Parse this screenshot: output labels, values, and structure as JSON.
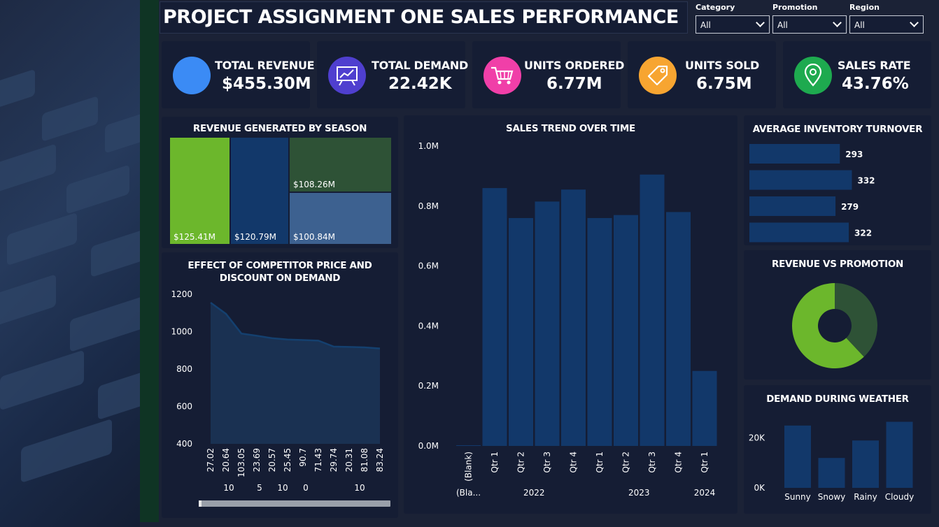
{
  "title": "PROJECT ASSIGNMENT ONE SALES PERFORMANCE",
  "slicers": [
    {
      "label": "Category",
      "value": "All"
    },
    {
      "label": "Promotion",
      "value": "All"
    },
    {
      "label": "Region",
      "value": "All"
    }
  ],
  "kpis": [
    {
      "label": "TOTAL REVENUE",
      "value": "$455.30M",
      "color": "#3b8bf5",
      "icon": "circle-icon"
    },
    {
      "label": "TOTAL DEMAND",
      "value": "22.42K",
      "color": "#4f3fcf",
      "icon": "chart-board-icon"
    },
    {
      "label": "UNITS ORDERED",
      "value": "6.77M",
      "color": "#f03fa8",
      "icon": "cart-icon"
    },
    {
      "label": "UNITS SOLD",
      "value": "6.75M",
      "color": "#f7a531",
      "icon": "tag-icon"
    },
    {
      "label": "SALES RATE",
      "value": "43.76%",
      "color": "#1eaa4f",
      "icon": "location-pin-icon"
    }
  ],
  "season": {
    "title": "REVENUE GENERATED BY SEASON",
    "tiles": [
      {
        "label": "$125.41M",
        "value": 125.41,
        "color": "#6cb72c"
      },
      {
        "label": "$120.79M",
        "value": 120.79,
        "color": "#12386a"
      },
      {
        "label": "$108.26M",
        "value": 108.26,
        "color": "#2e5236"
      },
      {
        "label": "$100.84M",
        "value": 100.84,
        "color": "#3d6190"
      }
    ]
  },
  "competitor": {
    "title_line1": "EFFECT OF COMPETITOR PRICE AND",
    "title_line2": "DISCOUNT ON DEMAND",
    "yticks": [
      "1200",
      "1000",
      "800",
      "600",
      "400"
    ],
    "xlabels": [
      "27.02",
      "20.64",
      "103.05",
      "23.69",
      "20.57",
      "25.45",
      "90.7",
      "71.43",
      "29.74",
      "20.31",
      "81.08",
      "83.24"
    ],
    "groups": [
      {
        "label": "10",
        "pos": 1.5
      },
      {
        "label": "5",
        "pos": 3.5
      },
      {
        "label": "10",
        "pos": 5
      },
      {
        "label": "0",
        "pos": 6.5
      },
      {
        "label": "10",
        "pos": 10
      }
    ]
  },
  "trend": {
    "title": "SALES TREND OVER TIME",
    "yticks": [
      "1.0M",
      "0.8M",
      "0.6M",
      "0.4M",
      "0.2M",
      "0.0M"
    ],
    "years": [
      {
        "label": "(Bla...",
        "from": 0,
        "to": 0
      },
      {
        "label": "2022",
        "from": 1,
        "to": 4
      },
      {
        "label": "2023",
        "from": 5,
        "to": 8
      },
      {
        "label": "2024",
        "from": 9,
        "to": 9
      }
    ]
  },
  "inventory": {
    "title": "AVERAGE INVENTORY TURNOVER",
    "labels": [
      "293",
      "332",
      "279",
      "322"
    ],
    "values": [
      293,
      332,
      279,
      322
    ]
  },
  "promotion": {
    "title": "REVENUE VS PROMOTION",
    "values": [
      62,
      38
    ],
    "colors": [
      "#6cb72c",
      "#2e5236"
    ]
  },
  "weather": {
    "title": "DEMAND DURING WEATHER",
    "yticks": [
      "20K",
      "0K"
    ]
  },
  "chart_data": [
    {
      "type": "bar",
      "title": "SALES TREND OVER TIME",
      "categories": [
        "(Blank)",
        "Qtr 1",
        "Qtr 2",
        "Qtr 3",
        "Qtr 4",
        "Qtr 1",
        "Qtr 2",
        "Qtr 3",
        "Qtr 4",
        "Qtr 1"
      ],
      "years": [
        "(Blank)",
        "2022",
        "2022",
        "2022",
        "2022",
        "2023",
        "2023",
        "2023",
        "2023",
        "2024"
      ],
      "values": [
        0,
        860000,
        760000,
        815000,
        855000,
        760000,
        770000,
        905000,
        780000,
        250000
      ],
      "ylim": [
        0,
        1000000
      ],
      "grid": false
    },
    {
      "type": "area",
      "title": "EFFECT OF COMPETITOR PRICE AND DISCOUNT ON DEMAND",
      "x": [
        "27.02",
        "20.64",
        "103.05",
        "23.69",
        "20.57",
        "25.45",
        "90.7",
        "71.43",
        "29.74",
        "20.31",
        "81.08",
        "83.24"
      ],
      "values": [
        1155,
        1095,
        990,
        978,
        965,
        958,
        955,
        952,
        920,
        918,
        916,
        910
      ],
      "ylim": [
        400,
        1200
      ]
    },
    {
      "type": "bar",
      "title": "AVERAGE INVENTORY TURNOVER",
      "categories": [
        "",
        "",
        "",
        ""
      ],
      "values": [
        293,
        332,
        279,
        322
      ]
    },
    {
      "type": "pie",
      "title": "REVENUE VS PROMOTION",
      "categories": [
        "",
        ""
      ],
      "values": [
        62,
        38
      ]
    },
    {
      "type": "bar",
      "title": "DEMAND DURING WEATHER",
      "categories": [
        "Sunny",
        "Snowy",
        "Rainy",
        "Cloudy"
      ],
      "values": [
        25000,
        12000,
        19000,
        26500
      ],
      "ylim": [
        0,
        30000
      ]
    }
  ]
}
